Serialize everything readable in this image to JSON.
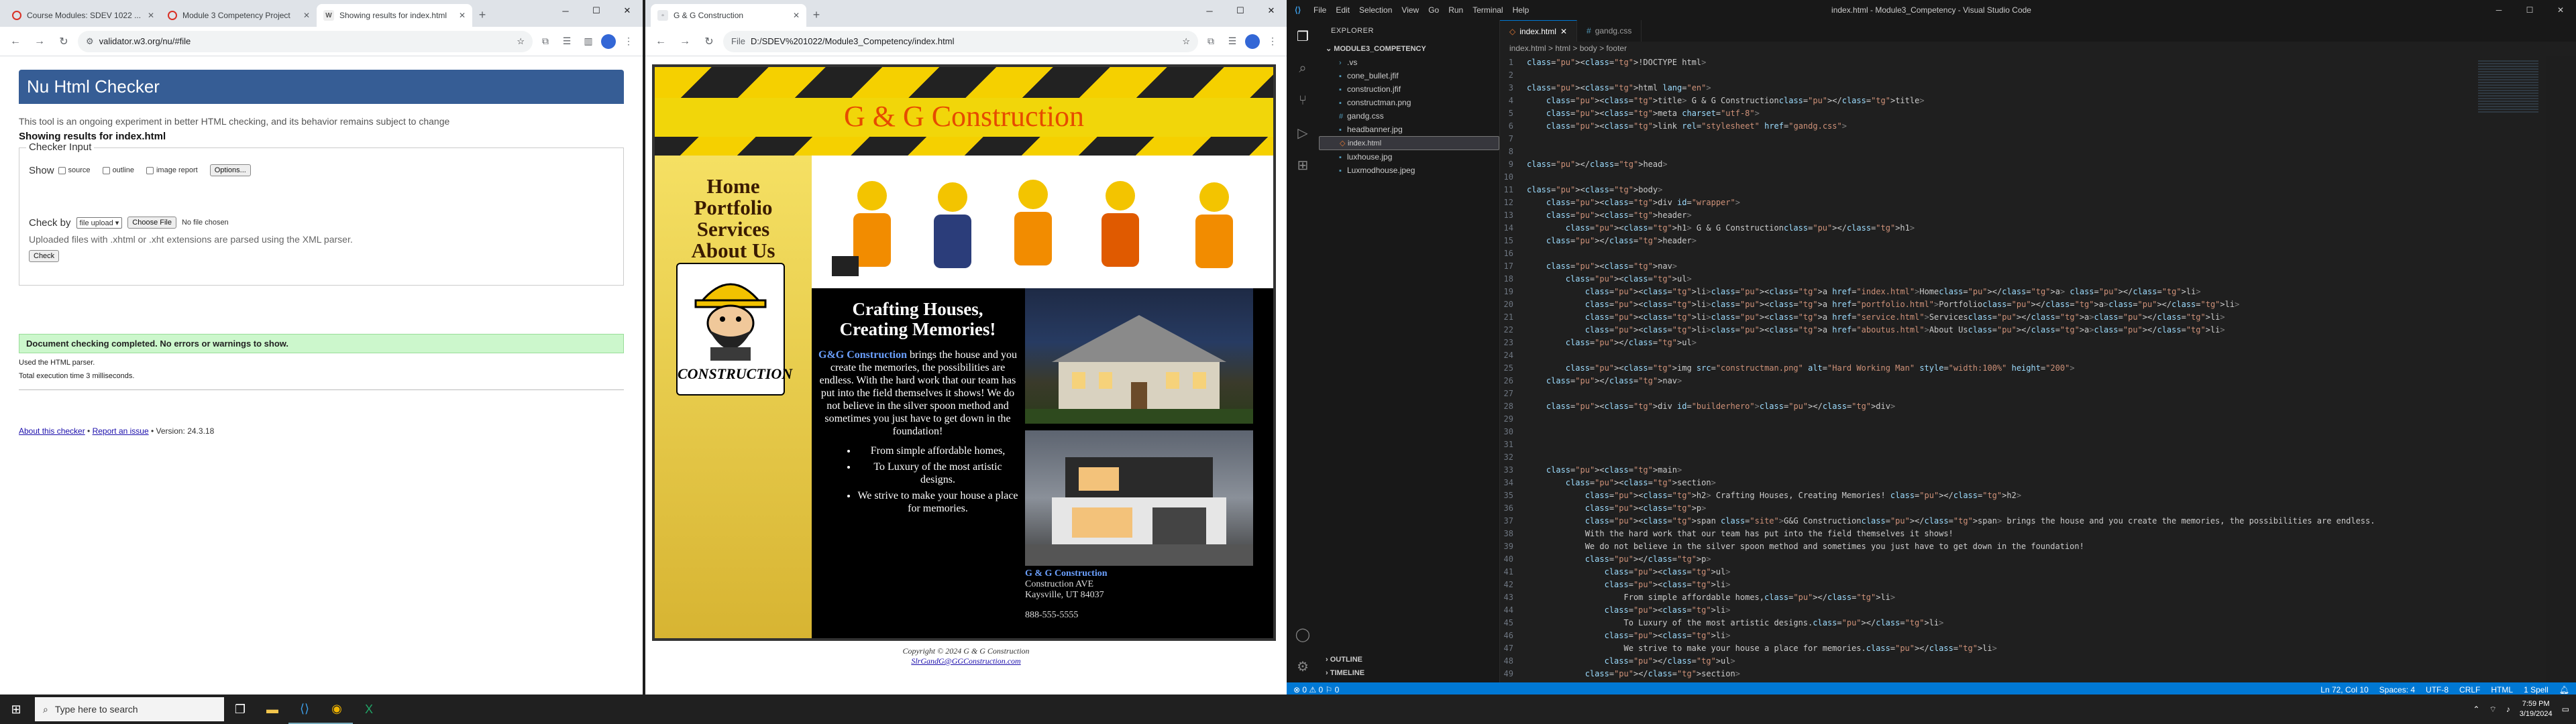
{
  "left_browser": {
    "tabs": [
      {
        "title": "Course Modules: SDEV 1022 ..."
      },
      {
        "title": "Module 3 Competency Project"
      },
      {
        "title": "Showing results for index.html"
      }
    ],
    "url": "validator.w3.org/nu/#file",
    "page": {
      "heading": "Nu Html Checker",
      "description": "This tool is an ongoing experiment in better HTML checking, and its behavior remains subject to change",
      "showing": "Showing results for index.html",
      "legend": "Checker Input",
      "show_label": "Show",
      "opt_source": "source",
      "opt_outline": "outline",
      "opt_image": "image report",
      "options_btn": "Options...",
      "checkby_label": "Check by",
      "checkby_value": "file upload",
      "choose_btn": "Choose File",
      "no_file": "No file chosen",
      "hint": "Uploaded files with .xhtml or .xht extensions are parsed using the XML parser.",
      "check_btn": "Check",
      "success": "Document checking completed. No errors or warnings to show.",
      "parser": "Used the HTML parser.",
      "time": "Total execution time 3 milliseconds.",
      "about": "About this checker",
      "report": "Report an issue",
      "version": "• Version: 24.3.18"
    }
  },
  "mid_browser": {
    "tab_title": "G & G Construction",
    "file_prefix": "File",
    "url": "D:/SDEV%201022/Module3_Competency/index.html",
    "site": {
      "h1": "G & G Construction",
      "nav": [
        "Home",
        "Portfolio",
        "Services",
        "About Us"
      ],
      "logo_text": "CONSTRUCTION",
      "h2": "Crafting Houses, Creating Memories!",
      "site_span": "G&G Construction",
      "para": " brings the house and you create the memories, the possibilities are endless. With the hard work that our team has put into the field themselves it shows! We do not believe in the silver spoon method and sometimes you just have to get down in the foundation!",
      "list": [
        "From simple affordable homes,",
        "To Luxury of the most artistic designs.",
        "We strive to make your house a place for memories."
      ],
      "addr_name": "G & G Construction",
      "addr1": "Construction AVE",
      "addr2": "Kaysville, UT 84037",
      "phone": "888-555-5555",
      "copyright": "Copyright © 2024 G & G Construction",
      "email": "SlrGandG@GGConstruction.com"
    }
  },
  "vscode": {
    "menu": [
      "File",
      "Edit",
      "Selection",
      "View",
      "Go",
      "Run",
      "Terminal",
      "Help"
    ],
    "window_title": "index.html - Module3_Competency - Visual Studio Code",
    "explorer_title": "EXPLORER",
    "folder": "MODULE3_COMPETENCY",
    "files": [
      ".vs",
      "cone_bullet.jfif",
      "construction.jfif",
      "constructman.png",
      "gandg.css",
      "headbanner.jpg",
      "index.html",
      "luxhouse.jpg",
      "Luxmodhouse.jpeg"
    ],
    "outline": "OUTLINE",
    "timeline": "TIMELINE",
    "tabs": [
      "index.html",
      "gandg.css"
    ],
    "breadcrumb": "index.html > html > body > footer",
    "code": [
      "<!DOCTYPE html>",
      "",
      "<html lang=\"en\">",
      "    <title> G & G Construction</title>",
      "    <meta charset=\"utf-8\">",
      "    <link rel=\"stylesheet\" href=\"gandg.css\">",
      "",
      "",
      "</head>",
      "",
      "<body>",
      "    <div id=\"wrapper\">",
      "    <header>",
      "        <h1> G & G Construction</h1>",
      "    </header>",
      "",
      "    <nav>",
      "        <ul>",
      "            <li><a href=\"index.html\">Home</a> </li>",
      "            <li><a href=\"portfolio.html\">Portfolio</a></li>",
      "            <li><a href=\"service.html\">Services</a></li>",
      "            <li><a href=\"aboutus.html\">About Us</a></li>",
      "        </ul>",
      "",
      "        <img src=\"constructman.png\" alt=\"Hard Working Man\" style=\"width:100%\" height=\"200\">",
      "    </nav>",
      "",
      "    <div id=\"builderhero\"></div>",
      "",
      "",
      "",
      "",
      "    <main>",
      "        <section>",
      "            <h2> Crafting Houses, Creating Memories! </h2>",
      "            <p>",
      "            <span class=\"site\">G&G Construction</span> brings the house and you create the memories, the possibilities are endless.",
      "            With the hard work that our team has put into the field themselves it shows!",
      "            We do not believe in the silver spoon method and sometimes you just have to get down in the foundation!",
      "            </p>",
      "                <ul>",
      "                <li>",
      "                    From simple affordable homes,</li>",
      "                <li>",
      "                    To Luxury of the most artistic designs.</li>",
      "                <li>",
      "                    We strive to make your house a place for memories.</li>",
      "                </ul>",
      "            </section>"
    ],
    "status_left": "⊗ 0 ⚠ 0   ⚐ 0",
    "status_right": [
      "Ln 72, Col 10",
      "Spaces: 4",
      "UTF-8",
      "CRLF",
      "HTML",
      "1 Spell"
    ]
  },
  "taskbar": {
    "search_placeholder": "Type here to search",
    "time": "7:59 PM",
    "date": "3/19/2024"
  }
}
